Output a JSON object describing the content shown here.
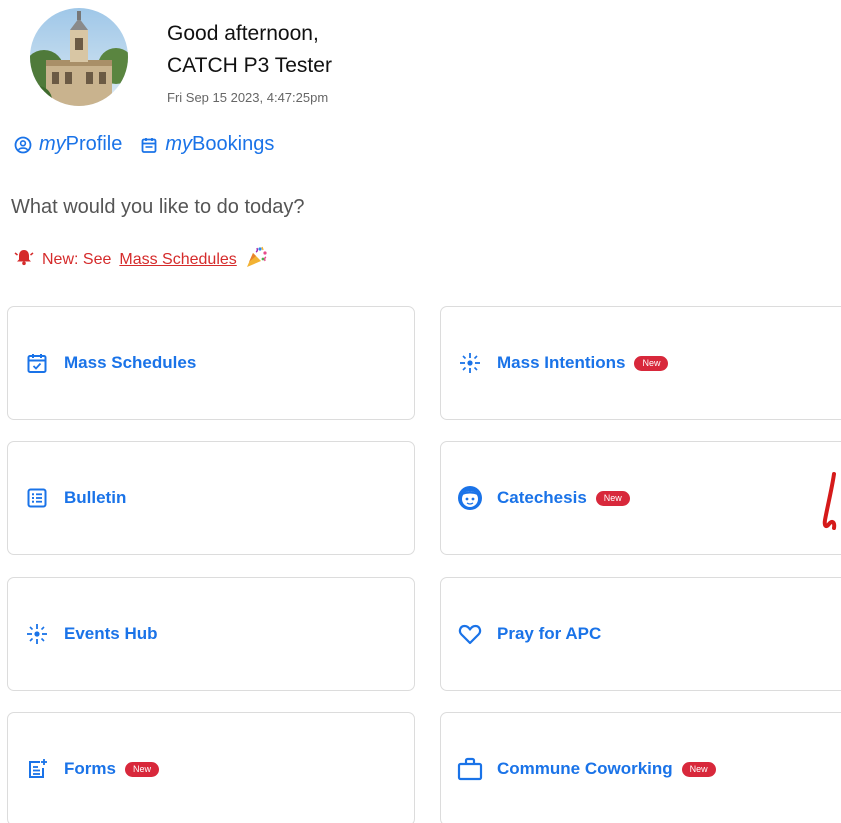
{
  "header": {
    "greeting_line1": "Good afternoon,",
    "greeting_line2": "CATCH P3 Tester",
    "timestamp": "Fri Sep 15 2023, 4:47:25pm"
  },
  "links": {
    "profile_prefix": "my",
    "profile_label": "Profile",
    "bookings_prefix": "my",
    "bookings_label": "Bookings"
  },
  "question": "What would you like to do today?",
  "announcement": {
    "prefix": "New: See",
    "link_label": "Mass Schedules",
    "bell_icon": "bell-icon",
    "party_icon": "party-popper-icon"
  },
  "badge_label": "New",
  "tiles": [
    {
      "label": "Mass Schedules",
      "icon": "calendar-check-icon",
      "is_new": false
    },
    {
      "label": "Mass Intentions",
      "icon": "sparkle-icon",
      "is_new": true
    },
    {
      "label": "Bulletin",
      "icon": "list-icon",
      "is_new": false
    },
    {
      "label": "Catechesis",
      "icon": "child-face-icon",
      "is_new": true
    },
    {
      "label": "Events Hub",
      "icon": "sparkle-icon",
      "is_new": false
    },
    {
      "label": "Pray for APC",
      "icon": "heart-icon",
      "is_new": false
    },
    {
      "label": "Forms",
      "icon": "form-add-icon",
      "is_new": true
    },
    {
      "label": "Commune Coworking",
      "icon": "briefcase-icon",
      "is_new": true
    }
  ],
  "colors": {
    "accent": "#1a73e8",
    "alert_red": "#d52b2b",
    "badge_red": "#d8283b",
    "tile_border": "#dcdcdc"
  }
}
